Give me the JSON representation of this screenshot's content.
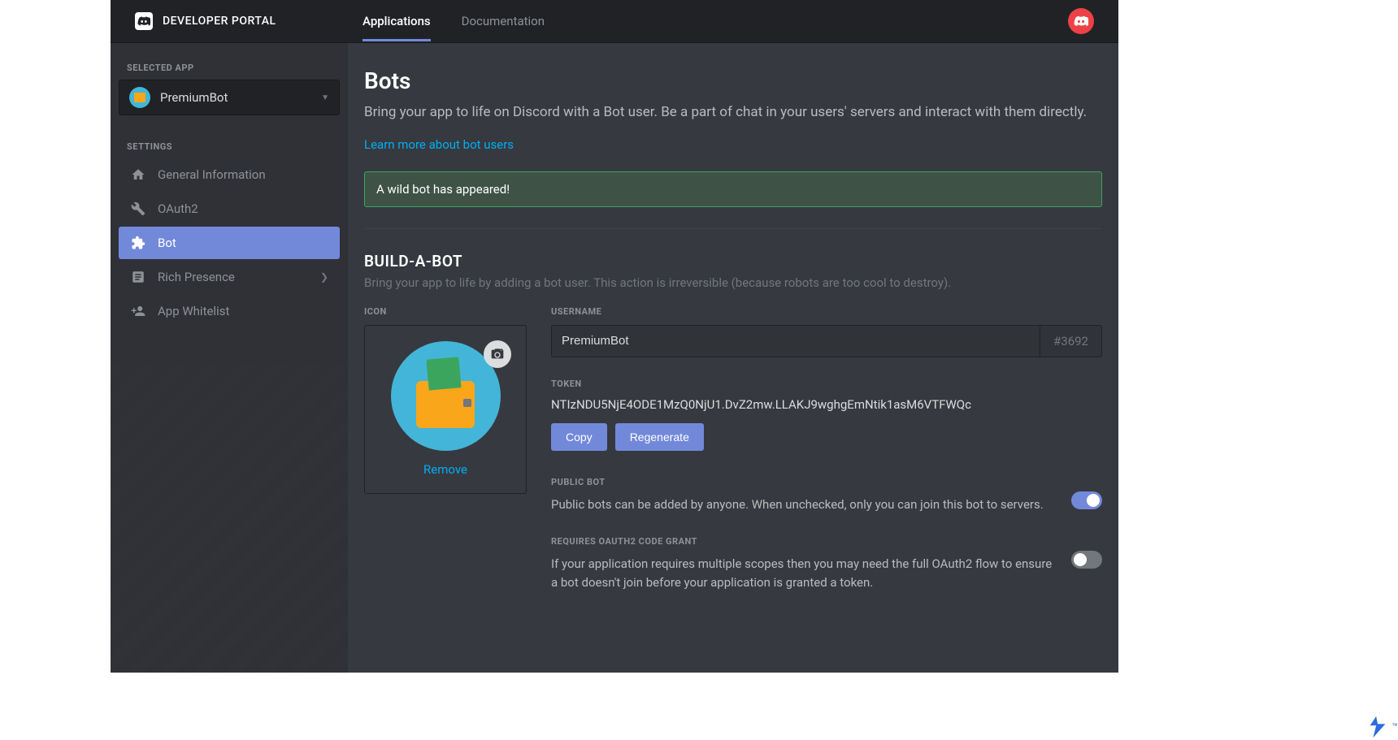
{
  "header": {
    "logo_text": "DEVELOPER PORTAL",
    "tabs": [
      {
        "label": "Applications",
        "active": true
      },
      {
        "label": "Documentation",
        "active": false
      }
    ]
  },
  "sidebar": {
    "selected_app_label": "SELECTED APP",
    "selected_app_name": "PremiumBot",
    "settings_label": "SETTINGS",
    "items": [
      {
        "label": "General Information",
        "icon": "home",
        "active": false,
        "chevron": false
      },
      {
        "label": "OAuth2",
        "icon": "wrench",
        "active": false,
        "chevron": false
      },
      {
        "label": "Bot",
        "icon": "puzzle",
        "active": true,
        "chevron": false
      },
      {
        "label": "Rich Presence",
        "icon": "document",
        "active": false,
        "chevron": true
      },
      {
        "label": "App Whitelist",
        "icon": "person-plus",
        "active": false,
        "chevron": false
      }
    ]
  },
  "page": {
    "title": "Bots",
    "subtitle": "Bring your app to life on Discord with a Bot user. Be a part of chat in your users' servers and interact with them directly.",
    "learn_more": "Learn more about bot users",
    "alert": "A wild bot has appeared!",
    "build_title": "BUILD-A-BOT",
    "build_description": "Bring your app to life by adding a bot user. This action is irreversible (because robots are too cool to destroy).",
    "icon_label": "ICON",
    "remove_label": "Remove",
    "username_label": "USERNAME",
    "username_value": "PremiumBot",
    "discriminator": "#3692",
    "token_label": "TOKEN",
    "token_value": "NTIzNDU5NjE4ODE1MzQ0NjU1.DvZ2mw.LLAKJ9wghgEmNtik1asM6VTFWQc",
    "copy_label": "Copy",
    "regenerate_label": "Regenerate",
    "public_bot_label": "PUBLIC BOT",
    "public_bot_description": "Public bots can be added by anyone. When unchecked, only you can join this bot to servers.",
    "public_bot_on": true,
    "oauth_label": "REQUIRES OAUTH2 CODE GRANT",
    "oauth_description": "If your application requires multiple scopes then you may need the full OAuth2 flow to ensure a bot doesn't join before your application is granted a token.",
    "oauth_on": false
  }
}
